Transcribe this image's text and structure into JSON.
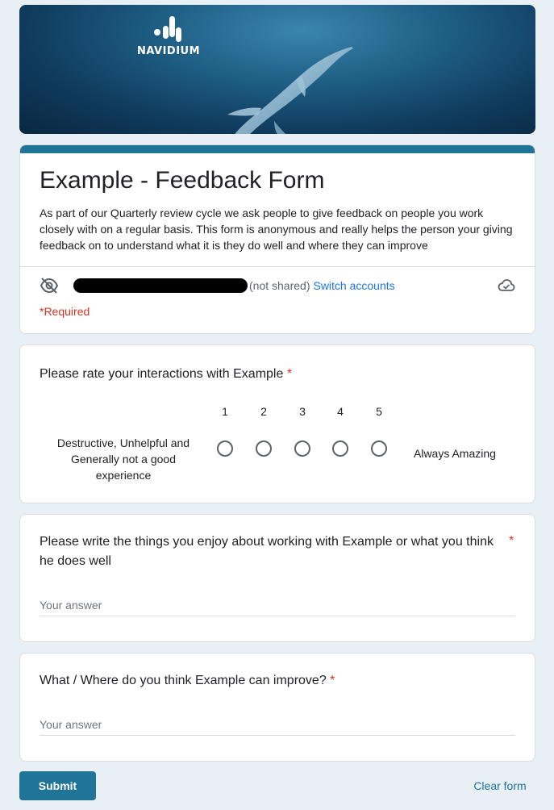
{
  "banner": {
    "brand": "NAVIDIUM"
  },
  "form": {
    "title": "Example - Feedback Form",
    "description": "As part of our Quarterly review cycle we ask people to give feedback on people you work closely with on a  regular basis. This form is anonymous and really helps the person your giving feedback on to understand what it is they do well and where they can improve",
    "not_shared": "(not shared)",
    "switch_accounts": "Switch accounts",
    "required_note": "*Required"
  },
  "questions": [
    {
      "title": "Please rate your interactions with Example",
      "required_mark": "*",
      "scale": [
        "1",
        "2",
        "3",
        "4",
        "5"
      ],
      "low_label": "Destructive, Unhelpful and Generally not a good experience",
      "high_label": "Always Amazing"
    },
    {
      "title_line1": "Please write the things you enjoy about working with Example or what you think",
      "title_line2": "he does well",
      "required_mark": "*",
      "placeholder": "Your answer"
    },
    {
      "title": "What / Where do you think Example can improve?",
      "required_mark": "*",
      "placeholder": "Your answer"
    }
  ],
  "actions": {
    "submit": "Submit",
    "clear": "Clear form"
  },
  "colors": {
    "accent": "#1f7497",
    "link": "#1a73e8",
    "required": "#d93025"
  },
  "icons": {
    "brand": "navidium-logo",
    "visibility": "eye-off-icon",
    "save_status": "cloud-check-icon"
  }
}
